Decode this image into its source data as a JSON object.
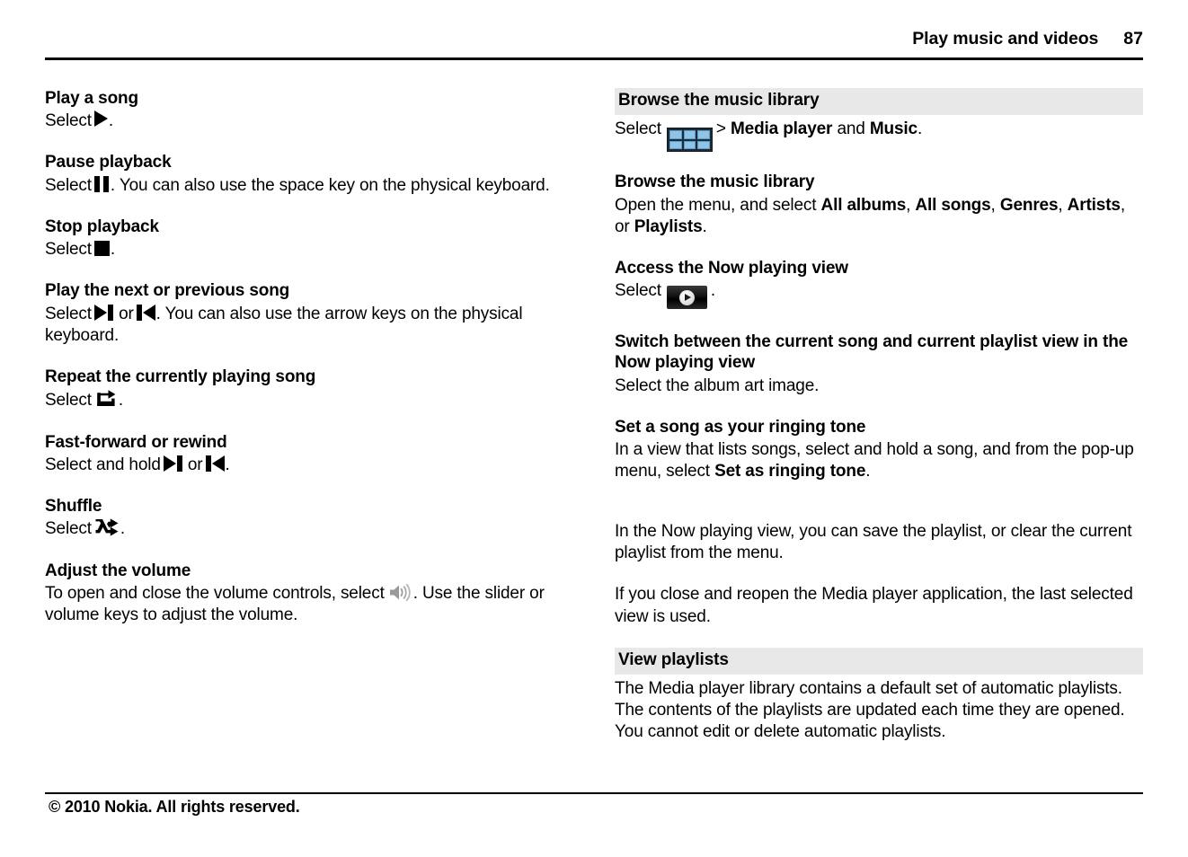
{
  "header": {
    "title": "Play music and videos",
    "page_number": "87"
  },
  "left_column": {
    "sections": [
      {
        "heading": "Play a song",
        "text_before": "Select",
        "icon": "play-icon",
        "text_after": "."
      },
      {
        "heading": "Pause playback",
        "text_before": "Select",
        "icon": "pause-icon",
        "text_after": ". You can also use the space key on the physical keyboard."
      },
      {
        "heading": "Stop playback",
        "text_before": "Select",
        "icon": "stop-icon",
        "text_after": "."
      },
      {
        "heading": "Play the next or previous song",
        "text_before": "Select",
        "icon": "next-track-icon",
        "text_middle": "or",
        "icon2": "previous-track-icon",
        "text_after": ". You can also use the arrow keys on the physical keyboard."
      },
      {
        "heading": "Repeat the currently playing song",
        "text_before": "Select",
        "icon": "repeat-icon",
        "text_after": "."
      },
      {
        "heading": "Fast-forward or rewind",
        "text_before": "Select and hold",
        "icon": "next-track-icon",
        "text_middle": "or",
        "icon2": "previous-track-icon",
        "text_after": "."
      },
      {
        "heading": "Shuffle",
        "text_before": "Select",
        "icon": "shuffle-icon",
        "text_after": "."
      },
      {
        "heading": "Adjust the volume",
        "text_before": "To open and close the volume controls, select",
        "icon": "volume-icon",
        "text_after": ". Use the slider or volume keys to adjust the volume."
      }
    ]
  },
  "right_column": {
    "band_heading_1": "Browse the music library",
    "band1_text_before": "Select",
    "band1_icon": "menu-grid-icon",
    "band1_text_mid": "> ",
    "band1_bold_1": "Media player",
    "band1_text_and": " and ",
    "band1_bold_2": "Music",
    "band1_text_end": ".",
    "sub_heading_1": "Browse the music library",
    "sub1_text_before": "Open the menu, and select ",
    "sub1_bold_1": "All albums",
    "sub1_sep_1": ", ",
    "sub1_bold_2": "All songs",
    "sub1_sep_2": ", ",
    "sub1_bold_3": "Genres",
    "sub1_sep_3": ", ",
    "sub1_bold_4": "Artists",
    "sub1_sep_4": ", or ",
    "sub1_bold_5": "Playlists",
    "sub1_text_end": ".",
    "sub_heading_2": "Access the Now playing view",
    "sub2_text_before": "Select",
    "sub2_icon": "now-playing-icon",
    "sub2_text_after": ".",
    "sub_heading_3": "Switch between the current song and current playlist view in the Now playing view",
    "sub3_text": "Select the album art image.",
    "sub_heading_4": "Set a song as your ringing tone",
    "sub4_text_before": "In a view that lists songs, select and hold a song, and from the pop-up menu, select ",
    "sub4_bold": "Set as ringing tone",
    "sub4_text_end": ".",
    "para_1": "In the Now playing view, you can save the playlist, or clear the current playlist from the menu.",
    "para_2": "If you close and reopen the Media player application, the last selected view is used.",
    "band_heading_2": "View playlists",
    "para_3": "The Media player library contains a default set of automatic playlists. The contents of the playlists are updated each time they are opened. You cannot edit or delete automatic playlists."
  },
  "footer": {
    "copyright": "© 2010 Nokia. All rights reserved."
  }
}
